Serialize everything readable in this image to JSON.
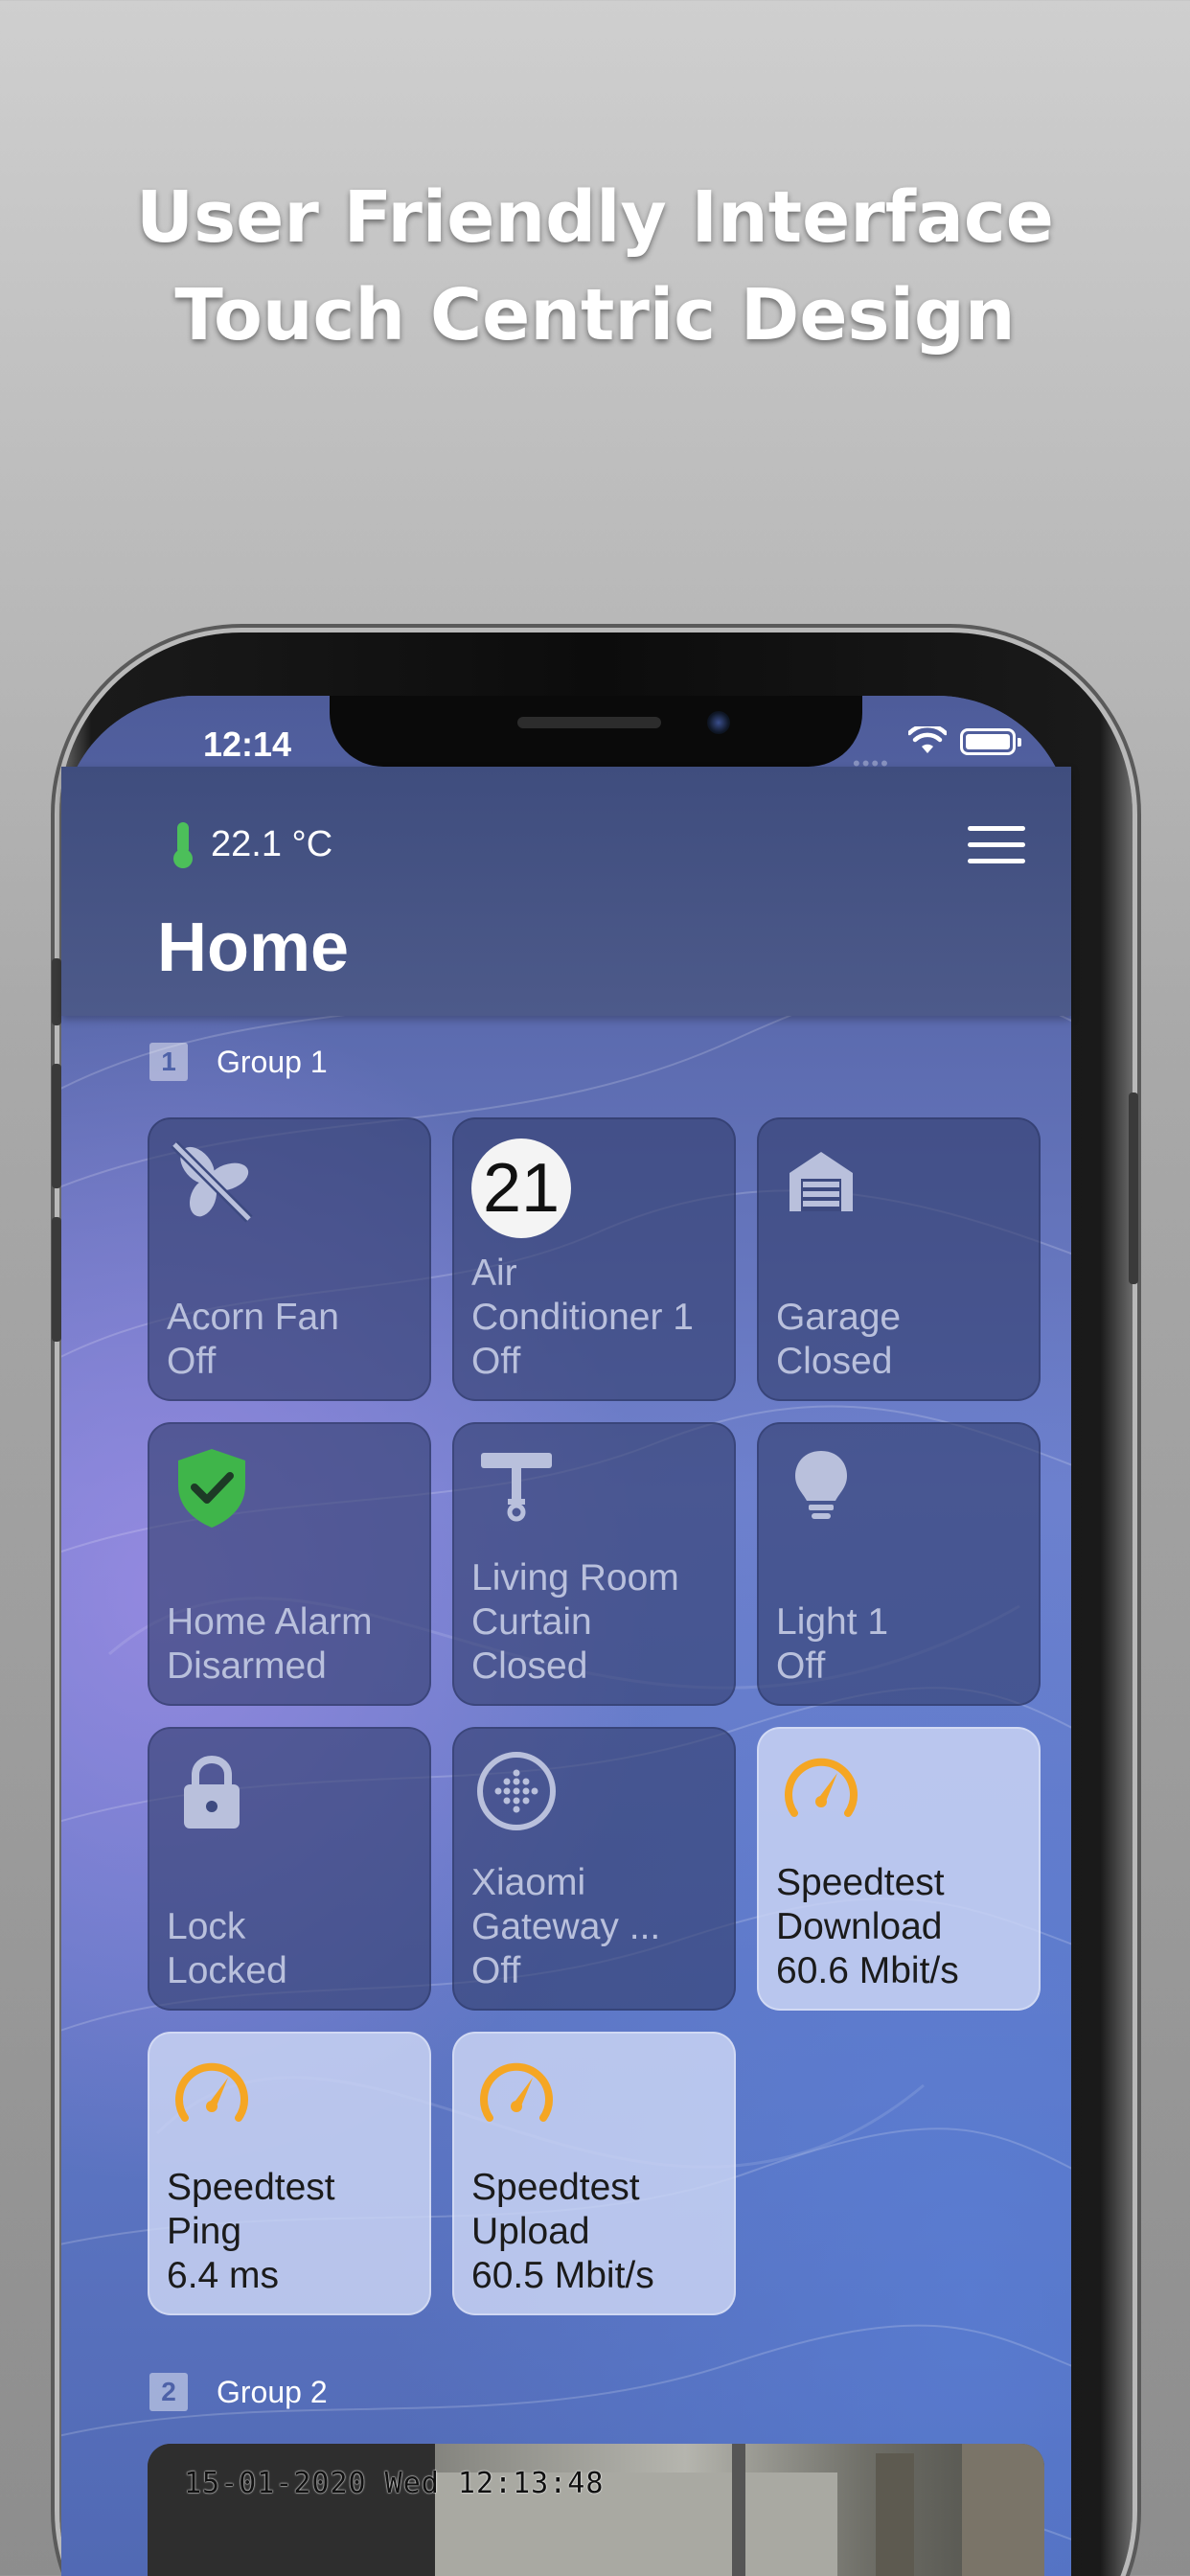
{
  "promo": {
    "line1": "User Friendly Interface",
    "line2": "Touch Centric Design"
  },
  "status_bar": {
    "time": "12:14",
    "dots": "••••"
  },
  "header": {
    "temperature": "22.1 °C",
    "title": "Home"
  },
  "groups": [
    {
      "num": "1",
      "label": "Group 1",
      "tiles": [
        {
          "icon": "fan-off-icon",
          "lines": [
            "Acorn Fan",
            "Off"
          ]
        },
        {
          "icon": "climate-badge",
          "badge": "21",
          "lines": [
            "Air",
            "Conditioner 1",
            "Off"
          ]
        },
        {
          "icon": "garage-icon",
          "lines": [
            "Garage",
            "Closed"
          ]
        },
        {
          "icon": "shield-check-icon",
          "lines": [
            "Home Alarm",
            "Disarmed"
          ]
        },
        {
          "icon": "curtain-icon",
          "lines": [
            "Living Room",
            "Curtain",
            "Closed"
          ]
        },
        {
          "icon": "lightbulb-icon",
          "lines": [
            "Light 1",
            "Off"
          ]
        },
        {
          "icon": "lock-icon",
          "lines": [
            "Lock",
            "Locked"
          ]
        },
        {
          "icon": "gateway-icon",
          "lines": [
            "Xiaomi",
            "Gateway ...",
            "Off"
          ]
        },
        {
          "icon": "speedometer-icon",
          "lines": [
            "Speedtest",
            "Download",
            "60.6 Mbit/s"
          ]
        },
        {
          "icon": "speedometer-icon",
          "lines": [
            "Speedtest",
            "Ping",
            "6.4 ms"
          ]
        },
        {
          "icon": "speedometer-icon",
          "lines": [
            "Speedtest",
            "Upload",
            "60.5 Mbit/s"
          ]
        }
      ]
    },
    {
      "num": "2",
      "label": "Group 2"
    }
  ],
  "camera": {
    "overlay": "15-01-2020 Wed 12:13:48"
  },
  "colors": {
    "accent_speed": "#f5a623",
    "alarm_green": "#3fb54a",
    "thermo_green": "#4cbf5a"
  }
}
